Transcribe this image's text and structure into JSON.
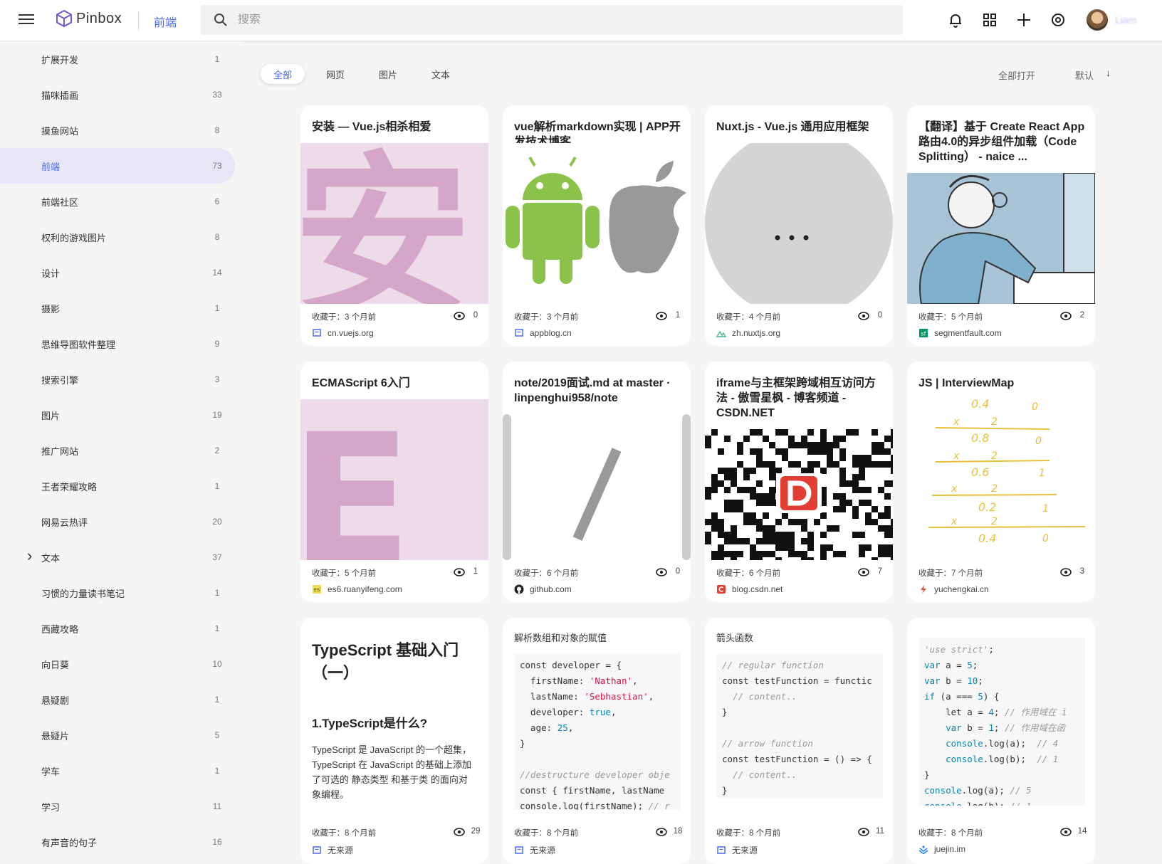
{
  "header": {
    "logo_text": "Pinbox",
    "current_category": "前端",
    "search_placeholder": "搜索",
    "username": "Liam"
  },
  "sidebar": {
    "items": [
      {
        "label": "扩展开发",
        "count": "1"
      },
      {
        "label": "猫咪插画",
        "count": "33"
      },
      {
        "label": "摸鱼网站",
        "count": "8"
      },
      {
        "label": "前端",
        "count": "73",
        "active": true
      },
      {
        "label": "前端社区",
        "count": "6"
      },
      {
        "label": "权利的游戏图片",
        "count": "8"
      },
      {
        "label": "设计",
        "count": "14"
      },
      {
        "label": "摄影",
        "count": "1"
      },
      {
        "label": "思维导图软件整理",
        "count": "9"
      },
      {
        "label": "搜索引擎",
        "count": "3"
      },
      {
        "label": "图片",
        "count": "19"
      },
      {
        "label": "推广网站",
        "count": "2"
      },
      {
        "label": "王者荣耀攻略",
        "count": "1"
      },
      {
        "label": "网易云热评",
        "count": "20"
      },
      {
        "label": "文本",
        "count": "37",
        "expandable": true
      },
      {
        "label": "习惯的力量读书笔记",
        "count": "1"
      },
      {
        "label": "西藏攻略",
        "count": "1"
      },
      {
        "label": "向日葵",
        "count": "10"
      },
      {
        "label": "悬疑剧",
        "count": "1"
      },
      {
        "label": "悬疑片",
        "count": "5"
      },
      {
        "label": "学车",
        "count": "1"
      },
      {
        "label": "学习",
        "count": "11"
      },
      {
        "label": "有声音的句子",
        "count": "16"
      }
    ]
  },
  "filters": {
    "tabs": [
      "全部",
      "网页",
      "图片",
      "文本"
    ],
    "active": "全部",
    "open_all": "全部打开",
    "sort": "默认"
  },
  "cards": [
    {
      "title": "安装 — Vue.js相杀相爱",
      "saved": "收藏于：3 个月前",
      "views": "0",
      "source": "cn.vuejs.org",
      "thumb_char": "安"
    },
    {
      "title": "vue解析markdown实现 | APP开发技术博客",
      "saved": "收藏于：3 个月前",
      "views": "1",
      "source": "appblog.cn"
    },
    {
      "title": "Nuxt.js - Vue.js 通用应用框架",
      "saved": "收藏于：4 个月前",
      "views": "0",
      "source": "zh.nuxtjs.org"
    },
    {
      "title": "【翻译】基于 Create React App路由4.0的异步组件加载（Code Splitting） - naice ...",
      "saved": "收藏于：5 个月前",
      "views": "2",
      "source": "segmentfault.com"
    },
    {
      "title": "ECMAScript 6入门",
      "saved": "收藏于：5 个月前",
      "views": "1",
      "source": "es6.ruanyifeng.com",
      "thumb_char": "E"
    },
    {
      "title": "note/2019面试.md at master · linpenghui958/note",
      "saved": "收藏于：6 个月前",
      "views": "0",
      "source": "github.com"
    },
    {
      "title": "iframe与主框架跨域相互访问方法 - 傲雪星枫 - 博客频道 - CSDN.NET",
      "saved": "收藏于：6 个月前",
      "views": "7",
      "source": "blog.csdn.net"
    },
    {
      "title": "JS | InterviewMap",
      "saved": "收藏于：7 个月前",
      "views": "3",
      "source": "yuchengkai.cn"
    },
    {
      "title": "TypeScript 基础入门（一）",
      "subtitle": "1.TypeScript是什么?",
      "body": "TypeScript 是 JavaScript 的一个超集，TypeScript 在 JavaScript 的基础上添加了可选的 静态类型 和基于类 的面向对象编程。",
      "saved": "收藏于：8 个月前",
      "views": "29",
      "source": "无来源"
    },
    {
      "title": "解析数组和对象的赋值",
      "saved": "收藏于：8 个月前",
      "views": "18",
      "source": "无来源"
    },
    {
      "title": "箭头函数",
      "saved": "收藏于：8 个月前",
      "views": "11",
      "source": "无来源"
    },
    {
      "saved": "收藏于：8 个月前",
      "views": "14",
      "source": "juejin.im"
    }
  ],
  "colors": {
    "accent": "#4a6cf7",
    "active_bg": "#e6e6f7",
    "pink": "#d4a6c8",
    "pink_bg": "#eedbe9"
  }
}
